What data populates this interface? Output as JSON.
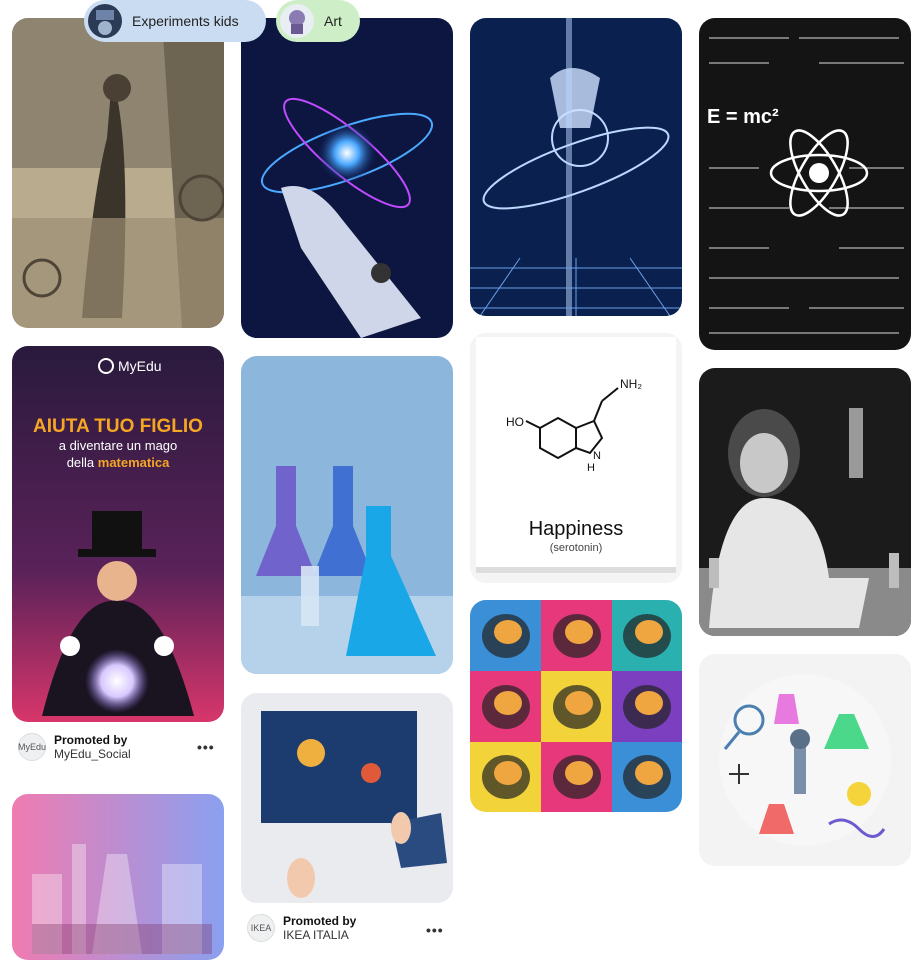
{
  "chips": [
    {
      "label": "Experiments kids"
    },
    {
      "label": "Art"
    }
  ],
  "pins": {
    "myedu": {
      "brand": "MyEdu",
      "headline": "AIUTA TUO FIGLIO",
      "line2": "a diventare un mago",
      "line3_prefix": "della ",
      "line3_highlight": "matematica"
    },
    "equations": {
      "formula": "E = mc²"
    },
    "serotonin": {
      "title": "Happiness",
      "subtitle": "(serotonin)",
      "nh2": "NH₂",
      "ho": "HO",
      "h": "H",
      "n": "N"
    }
  },
  "promotions": [
    {
      "label": "Promoted by",
      "advertiser": "MyEdu_Social",
      "avatar": "MyEdu",
      "more": "•••"
    },
    {
      "label": "Promoted by",
      "advertiser": "IKEA ITALIA",
      "avatar": "IKEA",
      "more": "•••"
    }
  ],
  "colors": {
    "chip_blue": "#c9dcf2",
    "chip_green": "#cdeec6",
    "myedu_bg": "#3a1d4f",
    "myedu_orange": "#f5a623"
  }
}
